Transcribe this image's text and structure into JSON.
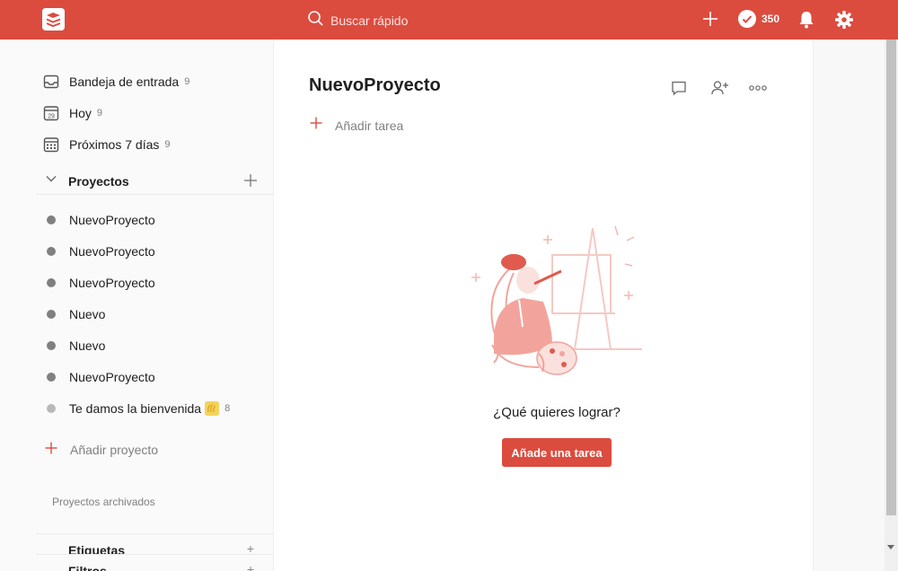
{
  "topbar": {
    "search_placeholder": "Buscar rápido",
    "karma_count": "350",
    "accent": "#db4c3f"
  },
  "sidebar": {
    "nav": [
      {
        "label": "Bandeja de entrada",
        "count": "9",
        "icon": "inbox-icon"
      },
      {
        "label": "Hoy",
        "count": "9",
        "icon": "calendar-today-icon",
        "day": "29"
      },
      {
        "label": "Próximos 7 días",
        "count": "9",
        "icon": "calendar-week-icon"
      }
    ],
    "projects_header": "Proyectos",
    "projects": [
      {
        "label": "NuevoProyecto"
      },
      {
        "label": "NuevoProyecto"
      },
      {
        "label": "NuevoProyecto"
      },
      {
        "label": "Nuevo"
      },
      {
        "label": "Nuevo"
      },
      {
        "label": "NuevoProyecto"
      },
      {
        "label": "Te damos la bienvenida",
        "count": "8",
        "icon": "waving-hand-icon"
      }
    ],
    "add_project": "Añadir proyecto",
    "archived": "Proyectos archivados",
    "labels_header": "Etiquetas",
    "filters_header": "Filtros"
  },
  "main": {
    "title": "NuevoProyecto",
    "add_task": "Añadir tarea",
    "empty_question": "¿Qué quieres lograr?",
    "cta": "Añade una tarea"
  }
}
